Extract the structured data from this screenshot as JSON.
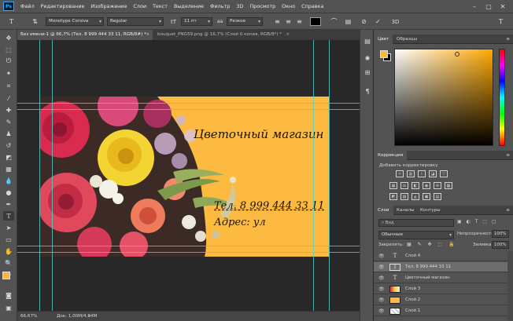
{
  "menu": {
    "items": [
      "Файл",
      "Редактирование",
      "Изображение",
      "Слои",
      "Текст",
      "Выделение",
      "Фильтр",
      "3D",
      "Просмотр",
      "Окно",
      "Справка"
    ],
    "logo": "Ps"
  },
  "options": {
    "font_family": "Monotype Corsiva",
    "font_style": "Regular",
    "font_size": "11 пт",
    "antialias": "Резкое",
    "text_color": "#000000"
  },
  "tabs": [
    {
      "label": "Без имени-1 @ 66,7% (Тел. 8 999 444 33 11, RGB/8#) *"
    },
    {
      "label": "bouquet_PNG59.png @ 16,7% (Слой 0 копия, RGB/8*) *"
    }
  ],
  "card": {
    "shop_name": "Цветочный магазин",
    "phone": "Тел. 8 999 444 33 11",
    "address": "Адрес: ул",
    "background": "#fcba40"
  },
  "status": {
    "zoom": "66,67%",
    "doc_info": "Док: 1,00М/4,94М"
  },
  "color_panel": {
    "tabs": [
      "Цвет",
      "Образцы"
    ],
    "foreground": "#f9b73f",
    "background": "#000000"
  },
  "correction_panel": {
    "title": "Коррекция",
    "subtitle": "Добавить корректировку"
  },
  "layers_panel": {
    "tabs": [
      "Слои",
      "Каналы",
      "Контуры"
    ],
    "search_placeholder": "Вид",
    "blend_mode": "Обычные",
    "opacity_label": "Непрозрачность:",
    "opacity_value": "100%",
    "lock_label": "Закрепить:",
    "fill_label": "Заливка:",
    "fill_value": "100%",
    "layers": [
      {
        "name": "Слой 4",
        "type": "text"
      },
      {
        "name": "Тел. 8 999 444 33 11",
        "type": "text"
      },
      {
        "name": "Цветочный магазин",
        "type": "text"
      },
      {
        "name": "Слой 3",
        "type": "image"
      },
      {
        "name": "Слой 2",
        "type": "fill"
      },
      {
        "name": "Слой 1",
        "type": "image"
      }
    ]
  }
}
